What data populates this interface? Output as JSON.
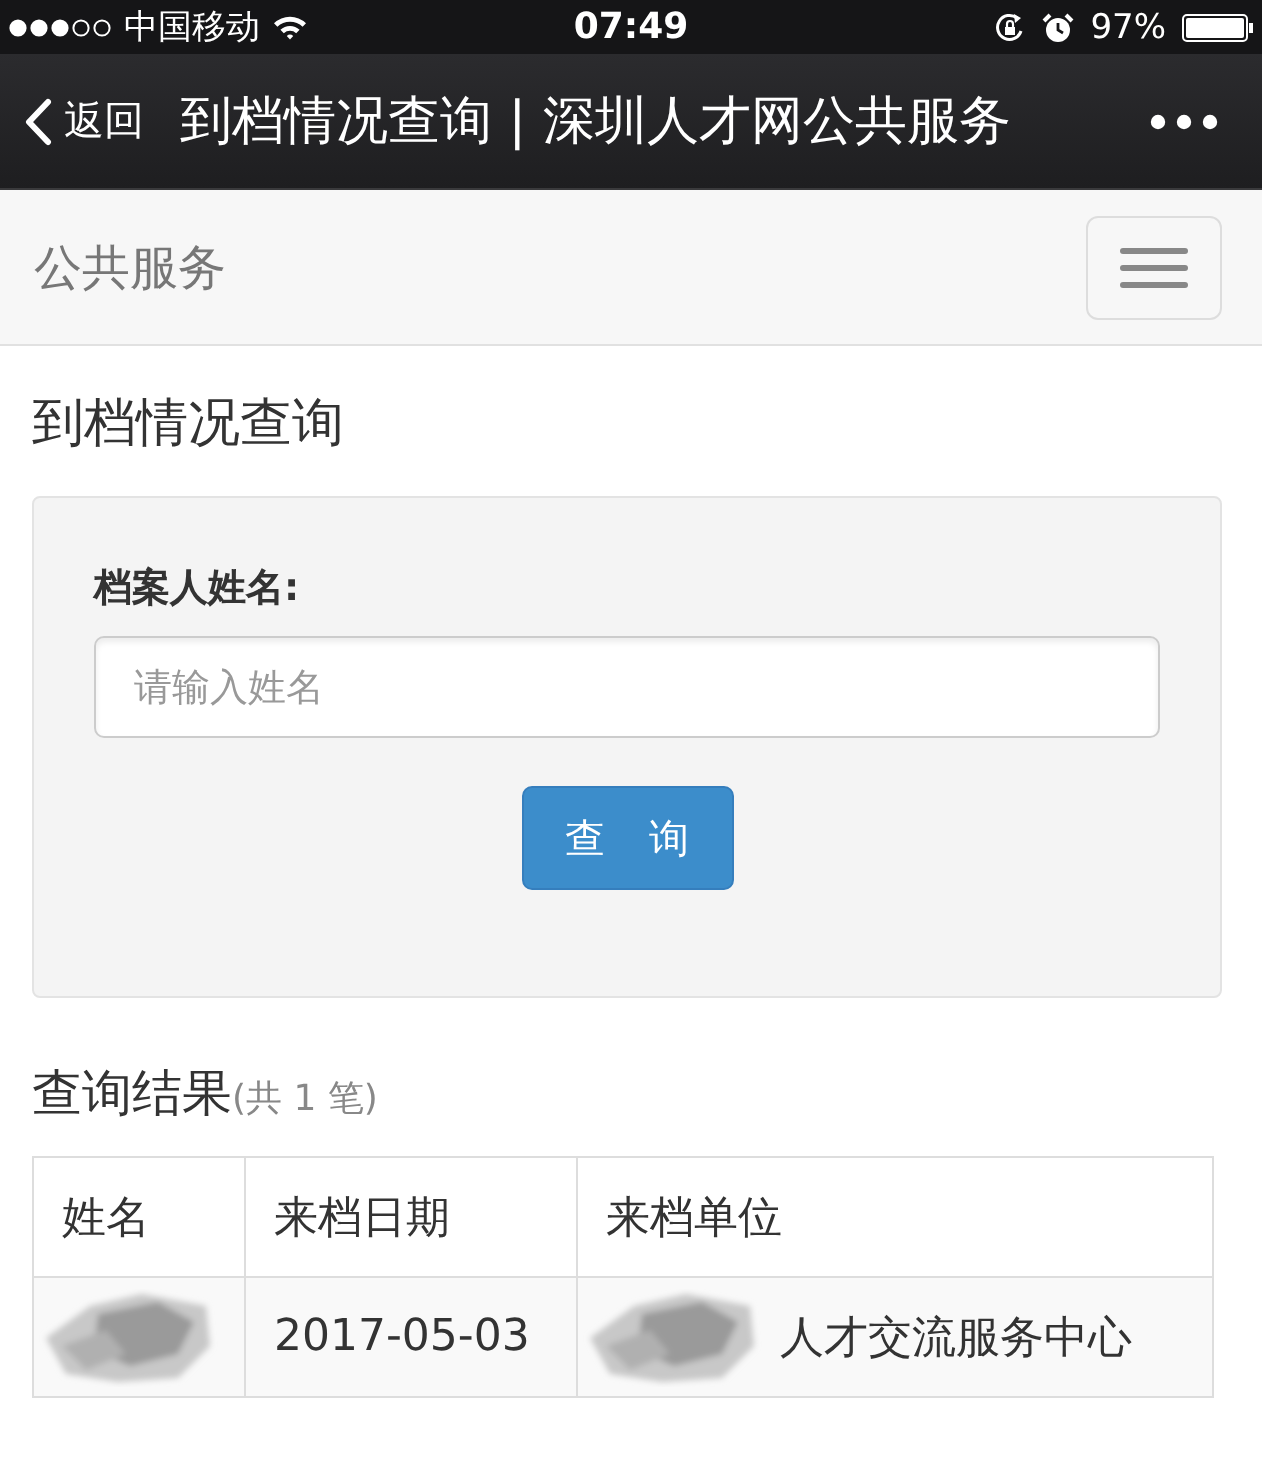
{
  "status_bar": {
    "carrier": "中国移动",
    "time": "07:49",
    "battery": "97%"
  },
  "nav_bar": {
    "back_label": "返回",
    "title": "到档情况查询 | 深圳人才网公共服务"
  },
  "site_header": {
    "brand": "公共服务"
  },
  "page_title": "到档情况查询",
  "query_form": {
    "label": "档案人姓名:",
    "placeholder": "请输入姓名",
    "submit": "查 询"
  },
  "results": {
    "heading": "查询结果",
    "count": "(共 1 笔)",
    "table": {
      "columns": [
        "姓名",
        "来档日期",
        "来档单位"
      ],
      "rows": [
        {
          "cells": [
            {
              "redacted": true
            },
            {
              "text": "2017-05-03",
              "redacted": false
            },
            {
              "text": "人才交流服务中心",
              "redacted": true
            }
          ]
        }
      ]
    }
  }
}
